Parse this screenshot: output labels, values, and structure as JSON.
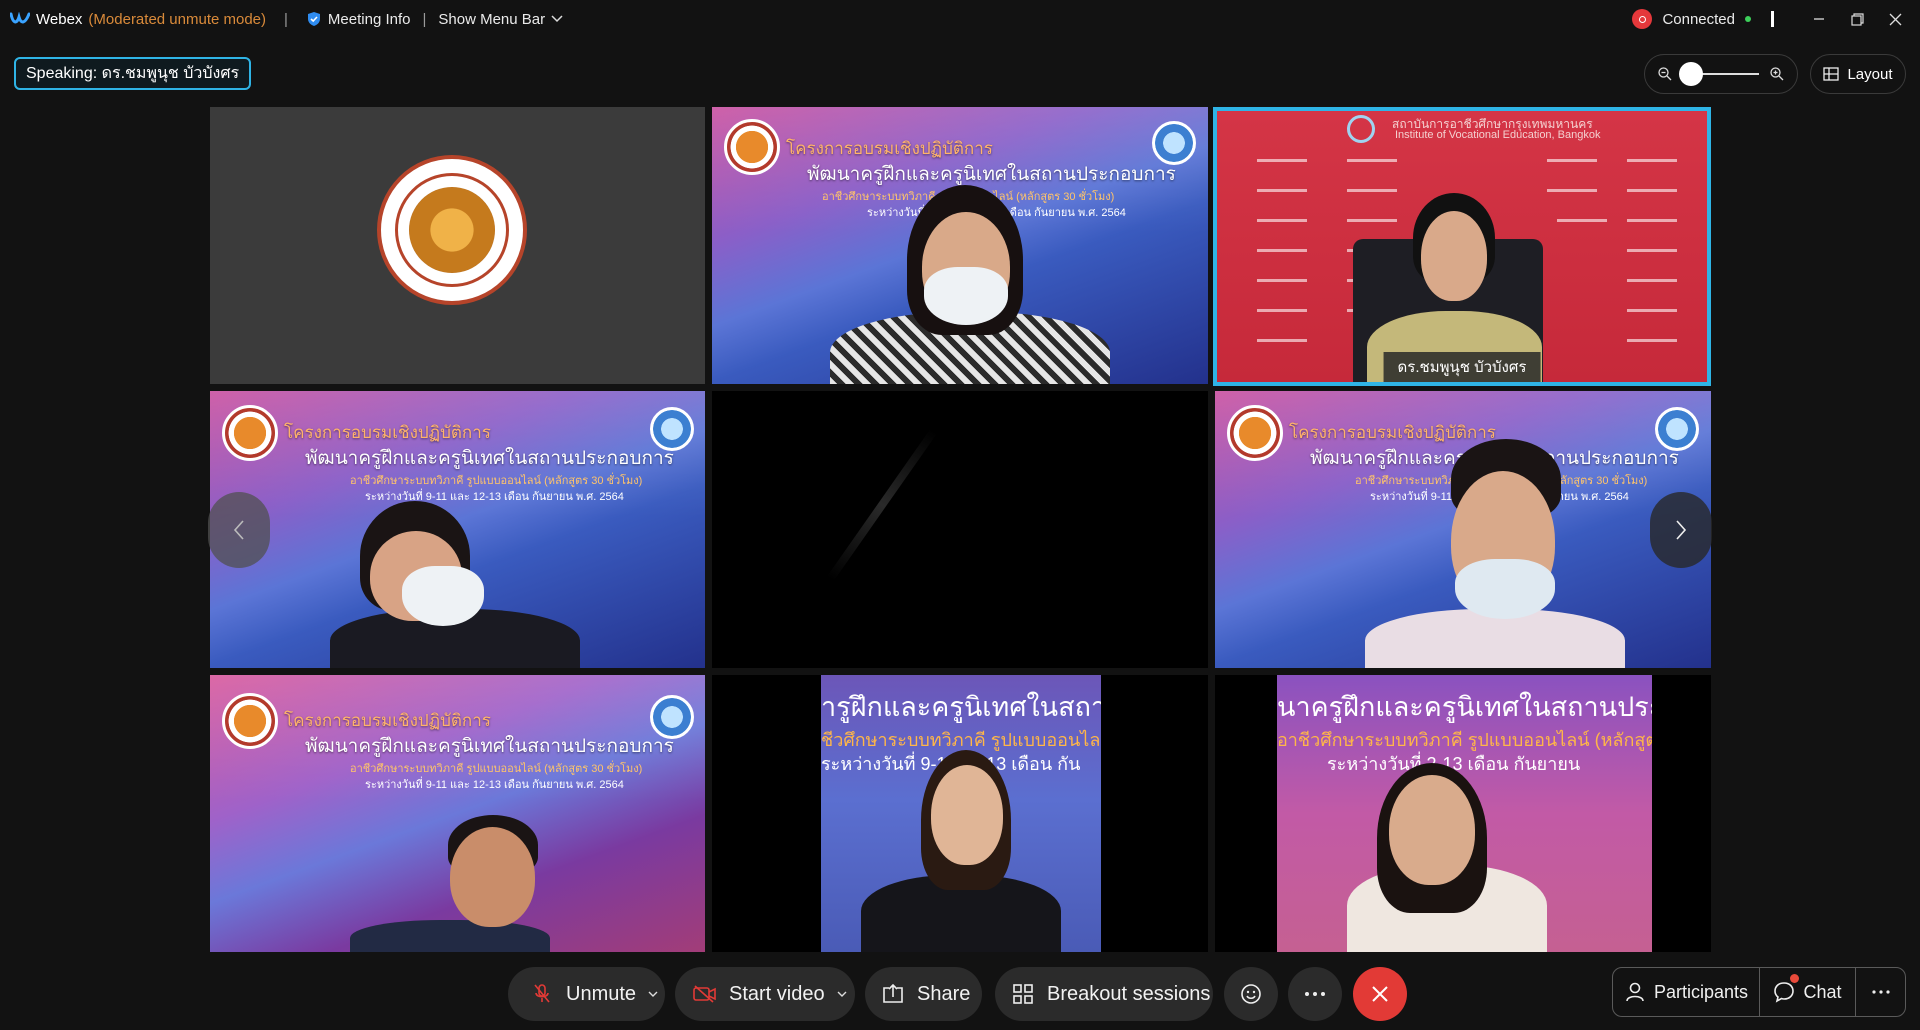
{
  "titlebar": {
    "app_name": "Webex",
    "mode": "(Moderated unmute mode)",
    "separator": "|",
    "meeting_info": "Meeting Info",
    "show_menu_bar": "Show Menu Bar",
    "connection_status": "Connected"
  },
  "speaking": {
    "label": "Speaking: ดร.ชมพูนุช บัวบังศร"
  },
  "view": {
    "layout_label": "Layout"
  },
  "tiles": {
    "banner": {
      "title_line1": "โครงการอบรมเชิงปฏิบัติการ",
      "title_line2": "พัฒนาครูฝึกและครูนิเทศในสถานประกอบการ",
      "sub_line1": "อาชีวศึกษาระบบทวิภาคี รูปแบบออนไลน์ (หลักสูตร 30 ชั่วโมง)",
      "sub_line2": "ระหว่างวันที่ 9-11 และ 12-13 เดือน กันยายน พ.ศ. 2564"
    },
    "active_speaker": {
      "header_th": "สถาบันการอาชีวศึกษากรุงเทพมหานคร",
      "header_en": "Institute of Vocational Education, Bangkok",
      "name": "ดร.ชมพูนุช บัวบังศร"
    },
    "crop_left": {
      "title": "ารูฝึกและครูนิเทศในสถานเ",
      "sub1": "ชีวศึกษาระบบทวิภาคี รูปแบบออนไลน์ (ห",
      "sub2": "ระหว่างวันที่  9-11      12-13 เดือน กัน"
    },
    "crop_right": {
      "title": "นาครูฝึกและครูนิเทศในสถานประก",
      "sub1": "อาชีวศึกษาระบบทวิภาคี รูปแบบออนไลน์ (หลักสูต",
      "sub2": "ระหว่างวันที่          2-13 เดือน กันยายน"
    }
  },
  "controls": {
    "unmute": "Unmute",
    "start_video": "Start video",
    "share": "Share",
    "breakout": "Breakout sessions",
    "participants": "Participants",
    "chat": "Chat"
  },
  "colors": {
    "accent": "#2fb4e6",
    "end_call": "#e23a36",
    "mode_text": "#d98a3a",
    "connected": "#3ccf5a"
  },
  "icons": [
    "webex-logo-icon",
    "shield-icon",
    "chevron-down-icon",
    "record-icon",
    "minimize-icon",
    "restore-icon",
    "close-icon",
    "zoom-out-icon",
    "zoom-in-icon",
    "layout-grid-icon",
    "microphone-muted-icon",
    "video-off-icon",
    "share-icon",
    "breakout-icon",
    "reaction-icon",
    "more-icon",
    "end-call-icon",
    "participants-icon",
    "chat-icon",
    "chevron-left-icon",
    "chevron-right-icon"
  ],
  "zoom_level": 0.05
}
